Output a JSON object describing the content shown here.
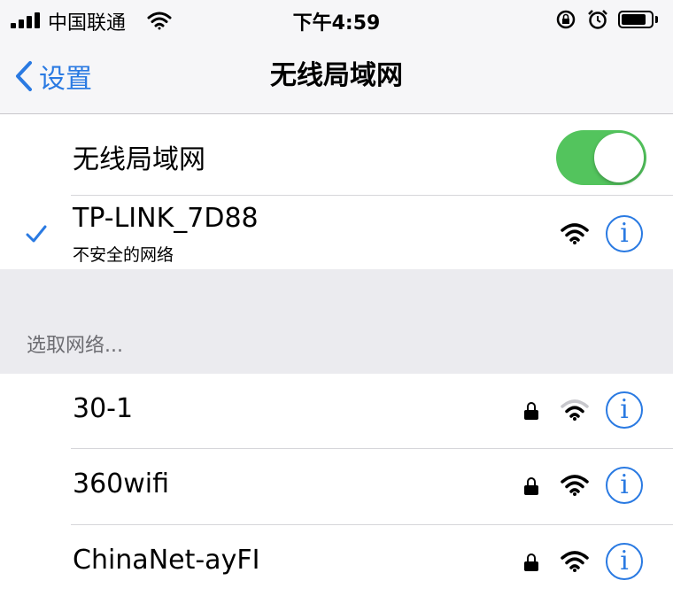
{
  "status_bar": {
    "carrier": "中国联通",
    "time": "下午4:59",
    "battery_level": 0.85
  },
  "nav": {
    "back_label": "设置",
    "title": "无线局域网"
  },
  "wifi_toggle": {
    "label": "无线局域网",
    "enabled": true
  },
  "connected_network": {
    "name": "TP-LINK_7D88",
    "subtitle": "不安全的网络"
  },
  "section_header": "选取网络...",
  "networks": [
    {
      "name": "30-1",
      "locked": true,
      "signal": "medium"
    },
    {
      "name": "360wifi",
      "locked": true,
      "signal": "full"
    },
    {
      "name": "ChinaNet-ayFI",
      "locked": true,
      "signal": "full"
    }
  ],
  "icons": {
    "info": "i",
    "accent_color": "#2a7ae2",
    "toggle_color": "#53c45d"
  }
}
